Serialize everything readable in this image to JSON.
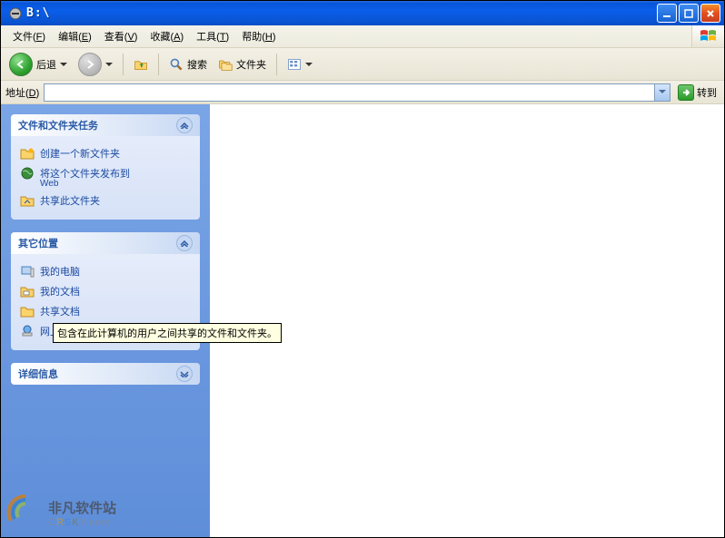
{
  "titlebar": {
    "text": "B:\\"
  },
  "menu": {
    "file": "文件",
    "file_k": "F",
    "edit": "编辑",
    "edit_k": "E",
    "view": "查看",
    "view_k": "V",
    "fav": "收藏",
    "fav_k": "A",
    "tools": "工具",
    "tools_k": "T",
    "help": "帮助",
    "help_k": "H"
  },
  "toolbar": {
    "back": "后退",
    "search": "搜索",
    "folders": "文件夹"
  },
  "address": {
    "label": "地址",
    "label_k": "D",
    "value": "",
    "go": "转到"
  },
  "sidebar": {
    "tasks": {
      "title": "文件和文件夹任务",
      "items": [
        {
          "label": "创建一个新文件夹"
        },
        {
          "label": "将这个文件夹发布到",
          "sub": "Web"
        },
        {
          "label": "共享此文件夹"
        }
      ]
    },
    "places": {
      "title": "其它位置",
      "items": [
        {
          "label": "我的电脑"
        },
        {
          "label": "我的文档"
        },
        {
          "label": "共享文档"
        },
        {
          "label": "网上邻居"
        }
      ]
    },
    "details": {
      "title": "详细信息"
    }
  },
  "tooltip": "包含在此计算机的用户之间共享的文件和文件夹。",
  "watermark": {
    "cn": "非凡软件站",
    "en": "CRSKY",
    "tld": ".com"
  }
}
